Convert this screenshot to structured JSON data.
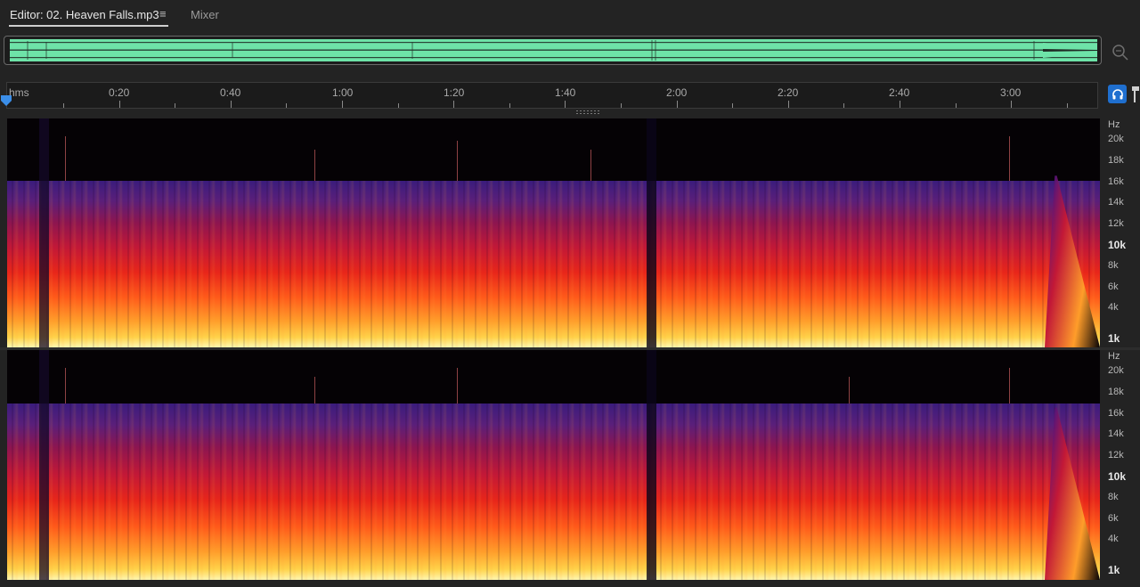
{
  "tabs": {
    "editor_label": "Editor: 02. Heaven Falls.mp3",
    "menu_glyph": "≡",
    "mixer_label": "Mixer"
  },
  "overview": {
    "wave_color": "#6ee3a8"
  },
  "ruler": {
    "unit_label": "hms",
    "labels": [
      "0:20",
      "0:40",
      "1:00",
      "1:20",
      "1:40",
      "2:00",
      "2:20",
      "2:40",
      "3:00"
    ]
  },
  "icons": {
    "zoom": "zoom-magnifier-icon",
    "monitor": "headphones-icon",
    "playhead": "playhead-marker-icon"
  },
  "freq_scale": {
    "unit": "Hz",
    "labels": [
      "20k",
      "18k",
      "16k",
      "14k",
      "12k",
      "10k",
      "8k",
      "6k",
      "4k",
      "1k"
    ]
  },
  "colors": {
    "accent": "#1f6fcf",
    "spectrum_low": "#fff7b0",
    "spectrum_mid": "#e8261a",
    "spectrum_high": "#3a1c7d"
  }
}
